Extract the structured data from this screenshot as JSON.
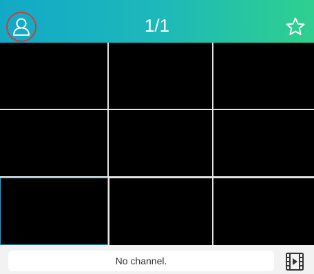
{
  "header": {
    "title": "1/1",
    "user_icon": "user-icon",
    "star_icon": "star-icon",
    "gradient_start": "#12a9c7",
    "gradient_end": "#2fd08e",
    "user_ring_color": "#d33a3a"
  },
  "grid": {
    "rows": 3,
    "columns": 3,
    "selected_cell": 7,
    "cell_color": "#000000",
    "selected_border_color": "#2aa3d8"
  },
  "bottom_bar": {
    "status_text": "No channel.",
    "playback_icon": "playback-video-icon"
  }
}
